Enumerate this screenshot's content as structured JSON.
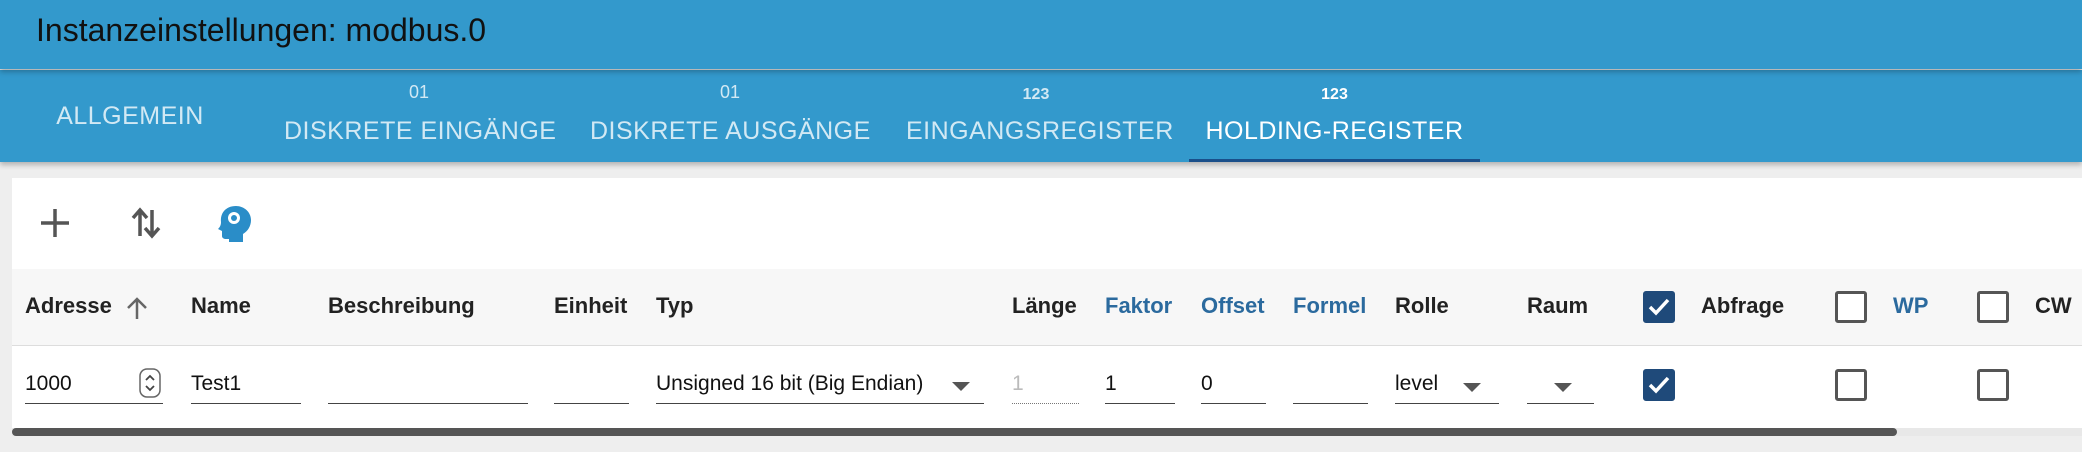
{
  "header": {
    "title": "Instanzeinstellungen: modbus.0"
  },
  "tabs": [
    {
      "label": "ALLGEMEIN",
      "icon": ""
    },
    {
      "label": "DISKRETE EINGÄNGE",
      "icon": "01"
    },
    {
      "label": "DISKRETE AUSGÄNGE",
      "icon": "01"
    },
    {
      "label": "EINGANGSREGISTER",
      "icon": "123"
    },
    {
      "label": "HOLDING-REGISTER",
      "icon": "123"
    }
  ],
  "active_tab": "HOLDING-REGISTER",
  "toolbar": {
    "icons": [
      "add-icon",
      "sort-arrows-icon",
      "ai-head-icon"
    ]
  },
  "table": {
    "columns": {
      "adresse": "Adresse",
      "name": "Name",
      "beschreibung": "Beschreibung",
      "einheit": "Einheit",
      "typ": "Typ",
      "laenge": "Länge",
      "faktor": "Faktor",
      "offset": "Offset",
      "formel": "Formel",
      "rolle": "Rolle",
      "raum": "Raum",
      "abfrage": "Abfrage",
      "wp": "WP",
      "cw": "CW"
    },
    "header_checkboxes": {
      "abfrage": true,
      "wp": false,
      "cw": false
    },
    "rows": [
      {
        "adresse": "1000",
        "name": "Test1",
        "beschreibung": "",
        "einheit": "",
        "typ": "Unsigned 16 bit (Big Endian)",
        "laenge": "1",
        "faktor": "1",
        "offset": "0",
        "formel": "",
        "rolle": "level",
        "raum": "",
        "abfrage": true,
        "wp": false,
        "cw": false
      }
    ]
  },
  "colors": {
    "appbar": "#3399cc",
    "accent": "#1f4a7a",
    "link_header": "#2b6a9e"
  }
}
